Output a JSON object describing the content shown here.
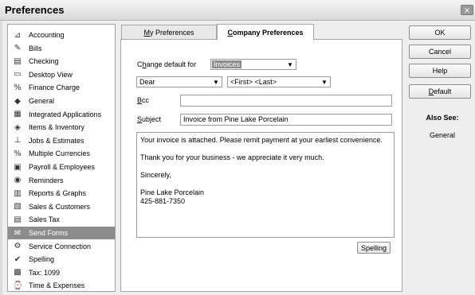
{
  "window": {
    "title": "Preferences",
    "close_glyph": "×"
  },
  "sidebar": {
    "items": [
      {
        "label": "Accounting",
        "icon": "accounting-icon",
        "glyph": "⊿"
      },
      {
        "label": "Bills",
        "icon": "bills-icon",
        "glyph": "✎"
      },
      {
        "label": "Checking",
        "icon": "checking-icon",
        "glyph": "▤"
      },
      {
        "label": "Desktop View",
        "icon": "desktop-view-icon",
        "glyph": "▭"
      },
      {
        "label": "Finance Charge",
        "icon": "finance-charge-icon",
        "glyph": "%"
      },
      {
        "label": "General",
        "icon": "general-icon",
        "glyph": "◆"
      },
      {
        "label": "Integrated Applications",
        "icon": "integrated-apps-icon",
        "glyph": "▦"
      },
      {
        "label": "Items & Inventory",
        "icon": "inventory-icon",
        "glyph": "◈"
      },
      {
        "label": "Jobs & Estimates",
        "icon": "jobs-icon",
        "glyph": "⊥"
      },
      {
        "label": "Multiple Currencies",
        "icon": "currencies-icon",
        "glyph": "%"
      },
      {
        "label": "Payroll & Employees",
        "icon": "payroll-icon",
        "glyph": "▣"
      },
      {
        "label": "Reminders",
        "icon": "reminders-icon",
        "glyph": "◉"
      },
      {
        "label": "Reports & Graphs",
        "icon": "reports-icon",
        "glyph": "▥"
      },
      {
        "label": "Sales & Customers",
        "icon": "sales-icon",
        "glyph": "▧"
      },
      {
        "label": "Sales Tax",
        "icon": "sales-tax-icon",
        "glyph": "▤"
      },
      {
        "label": "Send Forms",
        "icon": "send-forms-icon",
        "glyph": "✉",
        "selected": true
      },
      {
        "label": "Service Connection",
        "icon": "service-connection-icon",
        "glyph": "⚙"
      },
      {
        "label": "Spelling",
        "icon": "spelling-icon",
        "glyph": "✔"
      },
      {
        "label": "Tax: 1099",
        "icon": "tax-icon",
        "glyph": "▩"
      },
      {
        "label": "Time & Expenses",
        "icon": "time-icon",
        "glyph": "⌚"
      }
    ]
  },
  "tabs": {
    "my_prefix": "M",
    "my_rest": "y Preferences",
    "company_prefix": "C",
    "company_rest": "ompany Preferences"
  },
  "form": {
    "change_default_label_a": "C",
    "change_default_label_b": "h",
    "change_default_label_c": "ange default for",
    "change_default_value": "Invoices",
    "salutation_value": "Dear",
    "name_format_value": "<First> <Last>",
    "bcc_label_a": "B",
    "bcc_label_b": "cc",
    "bcc_value": "",
    "subject_label_a": "S",
    "subject_label_b": "ubject",
    "subject_value": "Invoice from Pine Lake Porcelain",
    "message_line1": "Your invoice is attached.  Please remit payment at your earliest convenience.",
    "message_line2": "Thank you for your business - we appreciate it very much.",
    "message_line3": "Sincerely,",
    "message_line4": "Pine Lake Porcelain",
    "message_line5": "425-881-7350",
    "spelling_btn_a": "Spellin",
    "spelling_btn_b": "g"
  },
  "buttons": {
    "ok": "OK",
    "cancel": "Cancel",
    "help": "Help",
    "default_a": "D",
    "default_b": "efault"
  },
  "also_see": {
    "heading": "Also See:",
    "link": "General"
  },
  "icons": {
    "dropdown": "▼"
  }
}
